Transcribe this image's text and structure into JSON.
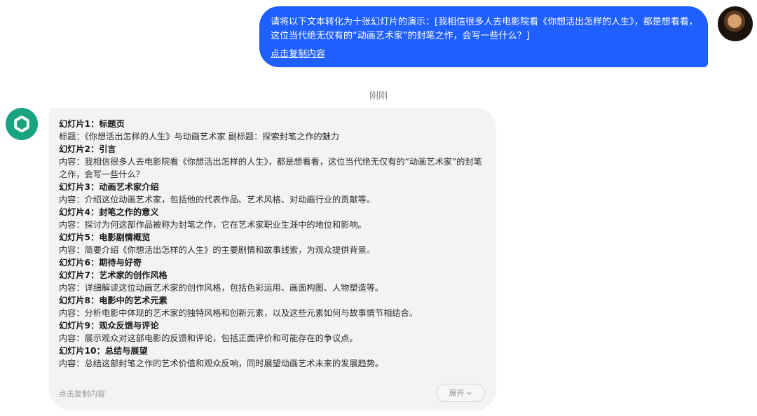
{
  "user_message": {
    "text": "请将以下文本转化为十张幻灯片的演示：[我相信很多人去电影院看《你想活出怎样的人生》，都是想看看，这位当代绝无仅有的“动画艺术家”的封笔之作，会写一些什么？]",
    "copy_label": "点击复制内容"
  },
  "timestamp": "刚刚",
  "bot_message": {
    "slides": [
      {
        "title": "幻灯片1：标题页",
        "body": "标题：《你想活出怎样的人生》与动画艺术家 副标题：探索封笔之作的魅力"
      },
      {
        "title": "幻灯片2：引言",
        "body": "内容：我相信很多人去电影院看《你想活出怎样的人生》，都是想看看，这位当代绝无仅有的“动画艺术家”的封笔之作，会写一些什么？"
      },
      {
        "title": "幻灯片3：动画艺术家介绍",
        "body": "内容：介绍这位动画艺术家，包括他的代表作品、艺术风格、对动画行业的贡献等。"
      },
      {
        "title": "幻灯片4：封笔之作的意义",
        "body": "内容：探讨为何这部作品被称为封笔之作，它在艺术家职业生涯中的地位和影响。"
      },
      {
        "title": "幻灯片5：电影剧情概览",
        "body": "内容：简要介绍《你想活出怎样的人生》的主要剧情和故事线索，为观众提供背景。"
      },
      {
        "title": "幻灯片6：期待与好奇",
        "body": ""
      },
      {
        "title": "幻灯片7：艺术家的创作风格",
        "body": "内容：详细解读这位动画艺术家的创作风格，包括色彩运用、画面构图、人物塑造等。"
      },
      {
        "title": "幻灯片8：电影中的艺术元素",
        "body": "内容：分析电影中体现的艺术家的独特风格和创新元素，以及这些元素如何与故事情节相结合。"
      },
      {
        "title": "幻灯片9：观众反馈与评论",
        "body": "内容：展示观众对这部电影的反馈和评论，包括正面评价和可能存在的争议点。"
      },
      {
        "title": "幻灯片10：总结与展望",
        "body": "内容：总结这部封笔之作的艺术价值和观众反响，同时展望动画艺术未来的发展趋势。"
      }
    ],
    "copy_label": "点击复制内容",
    "expand_label": "展开"
  },
  "colors": {
    "user_bubble": "#1f5fff",
    "bot_bubble": "#f3f3f4",
    "bot_avatar": "#19a37f"
  },
  "icons": {
    "bot_avatar": "openai-logo-icon",
    "expand": "chevron-down-icon"
  }
}
